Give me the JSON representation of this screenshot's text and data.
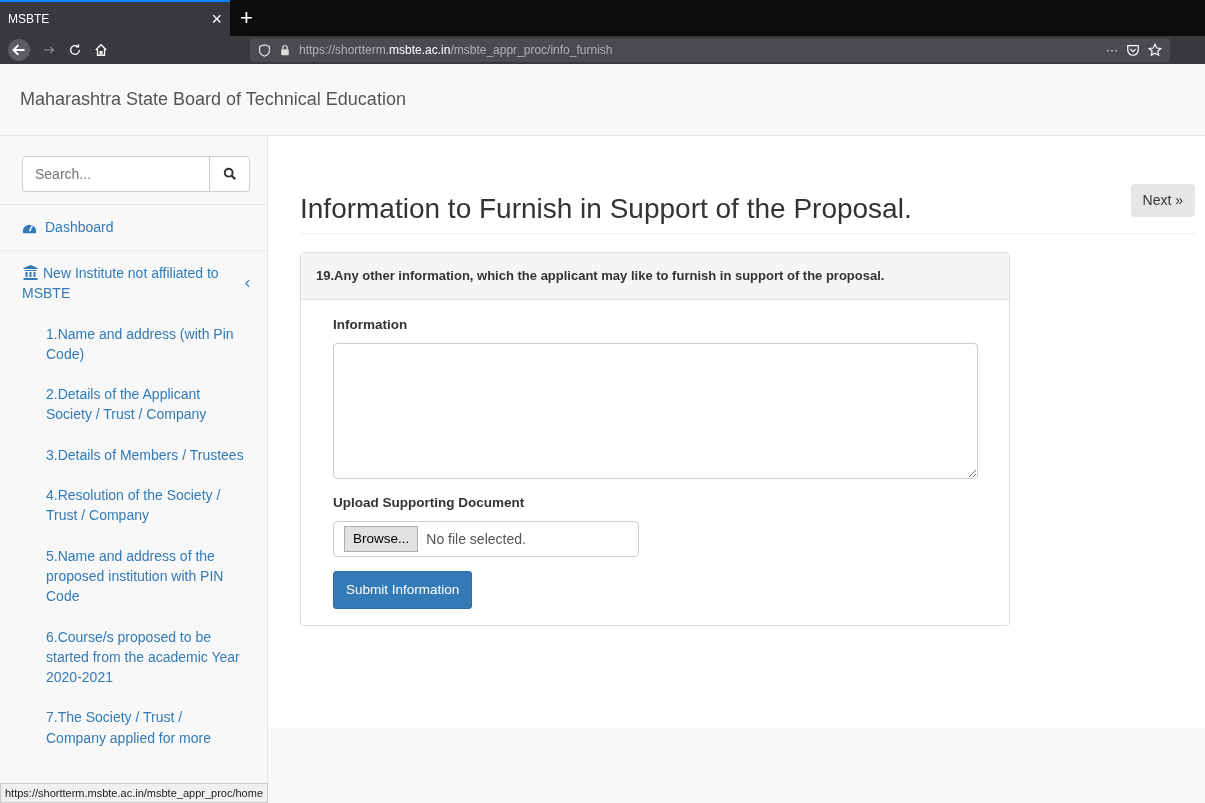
{
  "browser": {
    "tabs": [
      {
        "title": "MSBTE",
        "selected": true
      }
    ],
    "close_tab": "×",
    "new_tab": "+",
    "url": "https://shortterm.**msbte.ac.in**/msbte_appr_proc/info_furnish",
    "more": "···"
  },
  "navbar": {
    "brand": "Maharashtra State Board of Technical Education"
  },
  "sidebar": {
    "search": {
      "placeholder": "Search..."
    },
    "items": [
      {
        "label": "Dashboard",
        "kind": "dashboard"
      },
      {
        "label": "New Institute not affiliated to MSBTE",
        "kind": "institute",
        "expanded": true,
        "children": [
          {
            "label": "1.Name and address (with Pin Code)"
          },
          {
            "label": "2.Details of the Applicant Society / Trust / Company"
          },
          {
            "label": "3.Details of Members / Trustees"
          },
          {
            "label": "4.Resolution of the Society / Trust / Company"
          },
          {
            "label": "5.Name and address of the proposed institution with PIN Code"
          },
          {
            "label": "6.Course/s proposed to be started from the academic Year 2020-2021"
          },
          {
            "label": "7.The Society / Trust / Company applied for more"
          }
        ]
      }
    ]
  },
  "page": {
    "title": "Information to Furnish in Support of the Proposal.",
    "next_button": "Next »",
    "panel": {
      "heading": "19.Any other information, which the applicant may like to furnish in support of the proposal.",
      "info_label": "Information",
      "upload_label": "Upload Supporting Document",
      "browse_button": "Browse...",
      "file_status": "No file selected.",
      "submit_button": "Submit Information"
    }
  },
  "status_bar": "https://shortterm.msbte.ac.in/msbte_appr_proc/home"
}
